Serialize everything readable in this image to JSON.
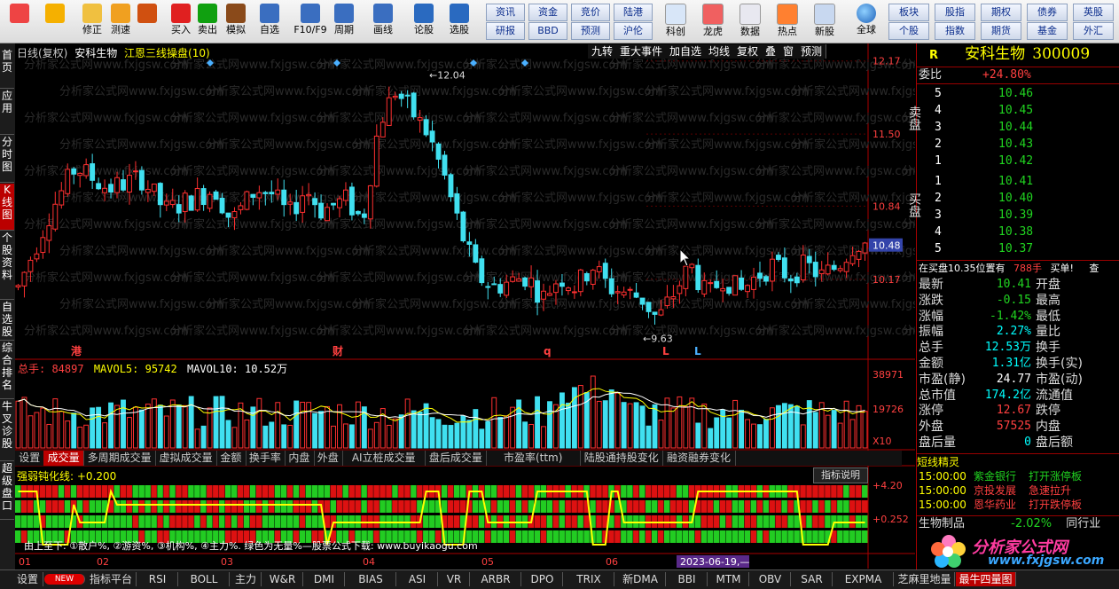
{
  "toolbar": {
    "buttons": [
      {
        "label": "",
        "icon": "grid-menu-icon"
      },
      {
        "label": "",
        "icon": "back-arrow-icon"
      },
      {
        "label": "修正",
        "icon": "up-down-arrows-icon"
      },
      {
        "label": "测速",
        "icon": "power-icon"
      },
      {
        "label": "",
        "icon": "clock-icon"
      },
      {
        "label": "买入",
        "icon": "buy-icon"
      },
      {
        "label": "卖出",
        "icon": "sell-icon"
      },
      {
        "label": "模拟",
        "icon": "gavel-icon"
      },
      {
        "label": "自选",
        "icon": "bookmark-icon"
      },
      {
        "label": "F10/F9",
        "icon": "window-icon"
      },
      {
        "label": "周期",
        "icon": "cycle-icon"
      },
      {
        "label": "画线",
        "icon": "pencil-icon"
      },
      {
        "label": "论股",
        "icon": "chat-icon"
      },
      {
        "label": "选股",
        "icon": "search-chart-icon"
      }
    ],
    "quick_row1": [
      "资讯",
      "资金",
      "竞价",
      "陆港"
    ],
    "quick_row2": [
      "研报",
      "BBD",
      "预测",
      "沪伦"
    ],
    "tools": [
      "科创",
      "龙虎",
      "数据",
      "热点",
      "新股"
    ],
    "global": "全球",
    "right_row1": [
      "板块",
      "股指",
      "期权",
      "债券",
      "英股"
    ],
    "right_row2": [
      "个股",
      "指数",
      "期货",
      "基金",
      "外汇"
    ]
  },
  "left_tabs": [
    "首页",
    "应用",
    "分时图",
    "K线图",
    "个股资料",
    "自选股",
    "综合排名",
    "牛叉诊股",
    "超级盘口"
  ],
  "chart": {
    "header": "日线(复权)",
    "stock_name": "安科生物",
    "indicator_name": "江恩三线操盘(10)",
    "tools": [
      "九转",
      "重大事件",
      "加自选",
      "均线",
      "复权",
      "叠",
      "窗",
      "预测"
    ],
    "price_labels": [
      "12.17",
      "11.50",
      "10.84",
      "10.48",
      "10.17"
    ],
    "current_price": "10.48",
    "high_marker": "12.04",
    "low_marker": "9.63",
    "event_labels": [
      "港",
      "财",
      "q",
      "L",
      "L"
    ],
    "watermark": "分析家公式网www.fxjgsw.com"
  },
  "chart_data": {
    "type": "candlestick",
    "title": "安科生物 日线(复权)",
    "ylim": [
      9.6,
      12.2
    ],
    "x_ticks": [
      "01",
      "02",
      "03",
      "04",
      "05",
      "06"
    ],
    "annotations": {
      "max": 12.04,
      "min": 9.63
    }
  },
  "volume": {
    "label_total": "总手: 84897",
    "label_ma5": "MAVOL5: 95742",
    "label_ma10": "MAVOL10: 10.52万",
    "axis": [
      "38971",
      "19726",
      "X10"
    ]
  },
  "mid_tabs": [
    "设置",
    "成交量",
    "多周期成交量",
    "虚拟成交量",
    "金额",
    "换手率",
    "内盘",
    "外盘",
    "AI立桩成交量",
    "盘后成交量",
    "市盈率(ttm)",
    "陆股通持股变化",
    "融资融券变化"
  ],
  "indicator": {
    "title": "强弱钝化线: +0.200",
    "explain_btn": "指标说明",
    "axis": [
      "+4.20",
      "+0.252"
    ],
    "footnote": "由上至下: ①散户%, ②游资%, ③机构%, ④主力%. 绿色为无量%—股票公式下载: www.buyikaogu.com"
  },
  "x_axis": {
    "labels": [
      "01",
      "02",
      "03",
      "04",
      "05",
      "06"
    ],
    "cursor_date": "2023-06-19,—"
  },
  "panel": {
    "flag": "R",
    "name": "安科生物",
    "code": "300009",
    "weibi_label": "委比",
    "weibi_value": "+24.80%",
    "sell_label": "卖盘",
    "buy_label": "买盘",
    "sell": [
      [
        "5",
        "10.46"
      ],
      [
        "4",
        "10.45"
      ],
      [
        "3",
        "10.44"
      ],
      [
        "2",
        "10.43"
      ],
      [
        "1",
        "10.42"
      ]
    ],
    "buy": [
      [
        "1",
        "10.41"
      ],
      [
        "2",
        "10.40"
      ],
      [
        "3",
        "10.39"
      ],
      [
        "4",
        "10.38"
      ],
      [
        "5",
        "10.37"
      ]
    ],
    "order_line": {
      "text": "在买盘10.35位置有",
      "qty": "788手",
      "tail": "买单!",
      "extra": "查"
    },
    "stats": [
      {
        "l": "最新",
        "v": "10.41",
        "c": "green",
        "r": "开盘"
      },
      {
        "l": "涨跌",
        "v": "-0.15",
        "c": "green",
        "r": "最高"
      },
      {
        "l": "涨幅",
        "v": "-1.42%",
        "c": "green",
        "r": "最低"
      },
      {
        "l": "振幅",
        "v": "2.27%",
        "c": "cyan",
        "r": "量比"
      },
      {
        "l": "总手",
        "v": "12.53万",
        "c": "cyan",
        "r": "换手"
      },
      {
        "l": "金额",
        "v": "1.31亿",
        "c": "cyan",
        "r": "换手(实)"
      },
      {
        "l": "市盈(静)",
        "v": "24.77",
        "c": "white",
        "r": "市盈(动)"
      },
      {
        "l": "总市值",
        "v": "174.2亿",
        "c": "cyan",
        "r": "流通值"
      },
      {
        "l": "涨停",
        "v": "12.67",
        "c": "red",
        "r": "跌停"
      },
      {
        "l": "外盘",
        "v": "57525",
        "c": "red",
        "r": "内盘"
      },
      {
        "l": "盘后量",
        "v": "0",
        "c": "cyan",
        "r": "盘后额"
      }
    ],
    "news_title": "短线精灵",
    "news": [
      {
        "time": "15:00:00",
        "name": "紫金银行",
        "event": "打开涨停板",
        "c": "green"
      },
      {
        "time": "15:00:00",
        "name": "京投发展",
        "event": "急速拉升",
        "c": "red"
      },
      {
        "time": "15:00:00",
        "name": "恩华药业",
        "event": "打开跌停板",
        "c": "red"
      }
    ],
    "sector": {
      "name": "生物制品",
      "change": "-2.02%",
      "extra": "同行业"
    },
    "logo_text": "分析家公式网",
    "logo_url": "www.fxjgsw.com"
  },
  "bottom_tabs": [
    "设置",
    "NEW",
    "指标平台",
    "RSI",
    "BOLL",
    "主力",
    "W&R",
    "DMI",
    "BIAS",
    "ASI",
    "VR",
    "ARBR",
    "DPO",
    "TRIX",
    "新DMA",
    "BBI",
    "MTM",
    "OBV",
    "SAR",
    "EXPMA",
    "芝麻里地量",
    "最牛四量图"
  ]
}
